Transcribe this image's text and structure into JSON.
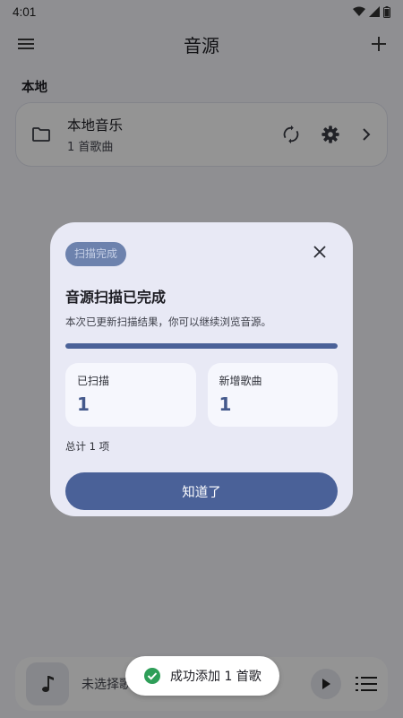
{
  "status_bar": {
    "time": "4:01"
  },
  "header": {
    "title": "音源"
  },
  "section": {
    "label": "本地"
  },
  "source": {
    "name": "本地音乐",
    "count": "1 首歌曲"
  },
  "player": {
    "track_text": "未选择歌曲"
  },
  "dialog": {
    "chip": "扫描完成",
    "title": "音源扫描已完成",
    "subtitle": "本次已更新扫描结果，你可以继续浏览音源。",
    "progress": 1.0,
    "stats": [
      {
        "label": "已扫描",
        "value": "1"
      },
      {
        "label": "新增歌曲",
        "value": "1"
      }
    ],
    "total": "总计 1 项",
    "ok_label": "知道了"
  },
  "toast": {
    "message": "成功添加 1 首歌"
  },
  "colors": {
    "accent": "#4a6198",
    "chip_bg": "#6d82ad",
    "success": "#2e9e58"
  },
  "icons": [
    "menu-icon",
    "add-icon",
    "folder-icon",
    "refresh-icon",
    "gear-icon",
    "chevron-right-icon",
    "close-icon",
    "music-note-icon",
    "play-icon",
    "queue-icon",
    "check-circle-icon",
    "wifi-icon",
    "signal-icon",
    "battery-icon"
  ]
}
